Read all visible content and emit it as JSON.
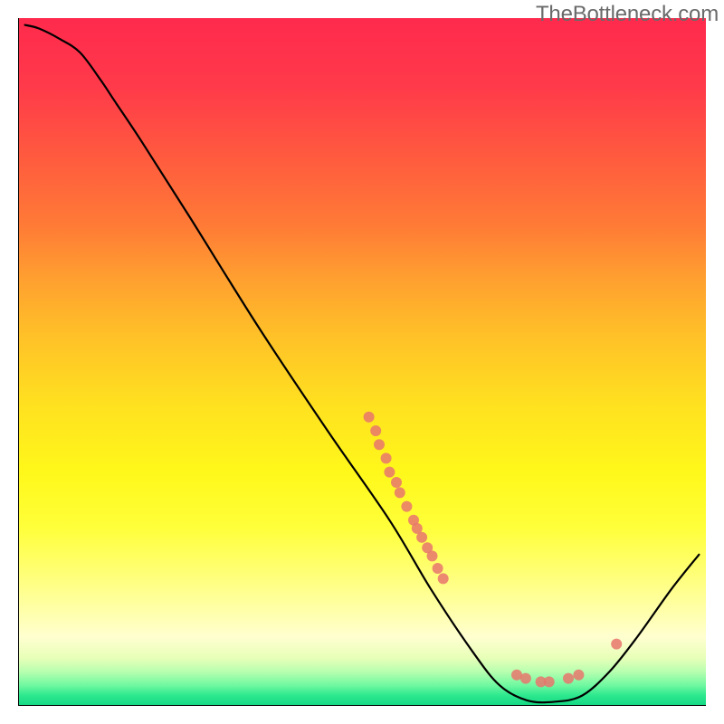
{
  "watermark": "TheBottleneck.com",
  "chart_data": {
    "type": "line",
    "title": "",
    "xlabel": "",
    "ylabel": "",
    "xlim": [
      0,
      100
    ],
    "ylim": [
      0,
      100
    ],
    "curve": [
      {
        "x": 1,
        "y": 99
      },
      {
        "x": 3,
        "y": 98.5
      },
      {
        "x": 6,
        "y": 97
      },
      {
        "x": 9,
        "y": 95
      },
      {
        "x": 12,
        "y": 91
      },
      {
        "x": 14,
        "y": 88
      },
      {
        "x": 18,
        "y": 82
      },
      {
        "x": 25,
        "y": 71
      },
      {
        "x": 35,
        "y": 55
      },
      {
        "x": 45,
        "y": 40
      },
      {
        "x": 54,
        "y": 27
      },
      {
        "x": 60,
        "y": 17
      },
      {
        "x": 66,
        "y": 8
      },
      {
        "x": 70,
        "y": 3
      },
      {
        "x": 74,
        "y": 0.8
      },
      {
        "x": 78,
        "y": 0.6
      },
      {
        "x": 82,
        "y": 1.5
      },
      {
        "x": 86,
        "y": 5
      },
      {
        "x": 90,
        "y": 10
      },
      {
        "x": 95,
        "y": 17
      },
      {
        "x": 99,
        "y": 22
      }
    ],
    "scatter_clusters": [
      {
        "x": 51,
        "y": 42
      },
      {
        "x": 52,
        "y": 40
      },
      {
        "x": 52.5,
        "y": 38
      },
      {
        "x": 53.5,
        "y": 36
      },
      {
        "x": 54,
        "y": 34
      },
      {
        "x": 55,
        "y": 32.5
      },
      {
        "x": 55.5,
        "y": 31
      },
      {
        "x": 56.5,
        "y": 29
      },
      {
        "x": 57.5,
        "y": 27
      },
      {
        "x": 58,
        "y": 25.8
      },
      {
        "x": 58.7,
        "y": 24.5
      },
      {
        "x": 59.5,
        "y": 23
      },
      {
        "x": 60.2,
        "y": 21.8
      },
      {
        "x": 61,
        "y": 20
      },
      {
        "x": 61.8,
        "y": 18.5
      },
      {
        "x": 72.5,
        "y": 4.5
      },
      {
        "x": 73.8,
        "y": 4
      },
      {
        "x": 76,
        "y": 3.5
      },
      {
        "x": 77.2,
        "y": 3.5
      },
      {
        "x": 80,
        "y": 4
      },
      {
        "x": 81.5,
        "y": 4.5
      },
      {
        "x": 87,
        "y": 9
      }
    ],
    "scatter_color": "#e8766d"
  }
}
